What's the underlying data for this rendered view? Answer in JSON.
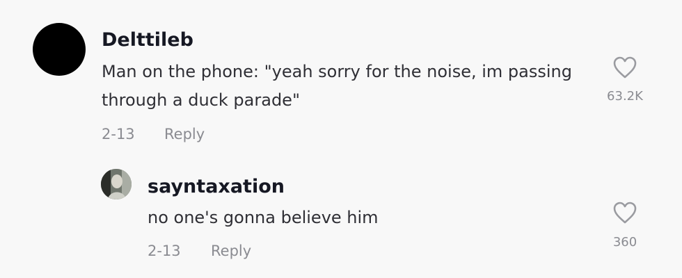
{
  "comments": [
    {
      "username": "Delttileb",
      "text": "Man on the phone: \"yeah sorry for the noise, im passing through a duck parade\"",
      "date": "2-13",
      "reply_label": "Reply",
      "like_icon": "heart-outline-icon",
      "likes": "63.2K"
    },
    {
      "username": "sayntaxation",
      "text": "no one's gonna believe him",
      "date": "2-13",
      "reply_label": "Reply",
      "like_icon": "heart-outline-icon",
      "likes": "360"
    }
  ],
  "colors": {
    "background": "#f8f8f8",
    "username": "#161823",
    "text": "#2f2f35",
    "meta": "#8a8b91"
  }
}
